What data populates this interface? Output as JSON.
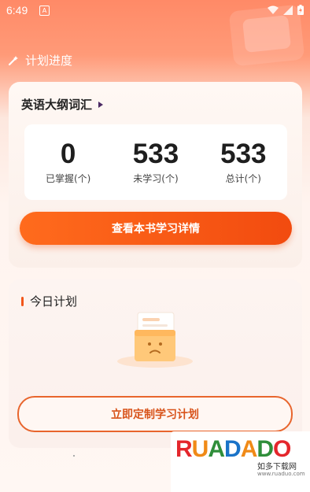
{
  "status": {
    "time": "6:49",
    "alert": "A"
  },
  "section_title": "计划进度",
  "book": {
    "title": "英语大纲词汇",
    "stats": [
      {
        "value": "0",
        "label": "已掌握(个)"
      },
      {
        "value": "533",
        "label": "未学习(个)"
      },
      {
        "value": "533",
        "label": "总计(个)"
      }
    ],
    "detail_button": "查看本书学习详情"
  },
  "plan": {
    "title": "今日计划",
    "create_button": "立即定制学习计划"
  },
  "watermark": {
    "brand": "RUADADO",
    "subtitle": "如多下载网",
    "url": "www.ruaduo.com"
  },
  "colors": {
    "accent": "#f24b0f",
    "header": "#ff8a67"
  }
}
